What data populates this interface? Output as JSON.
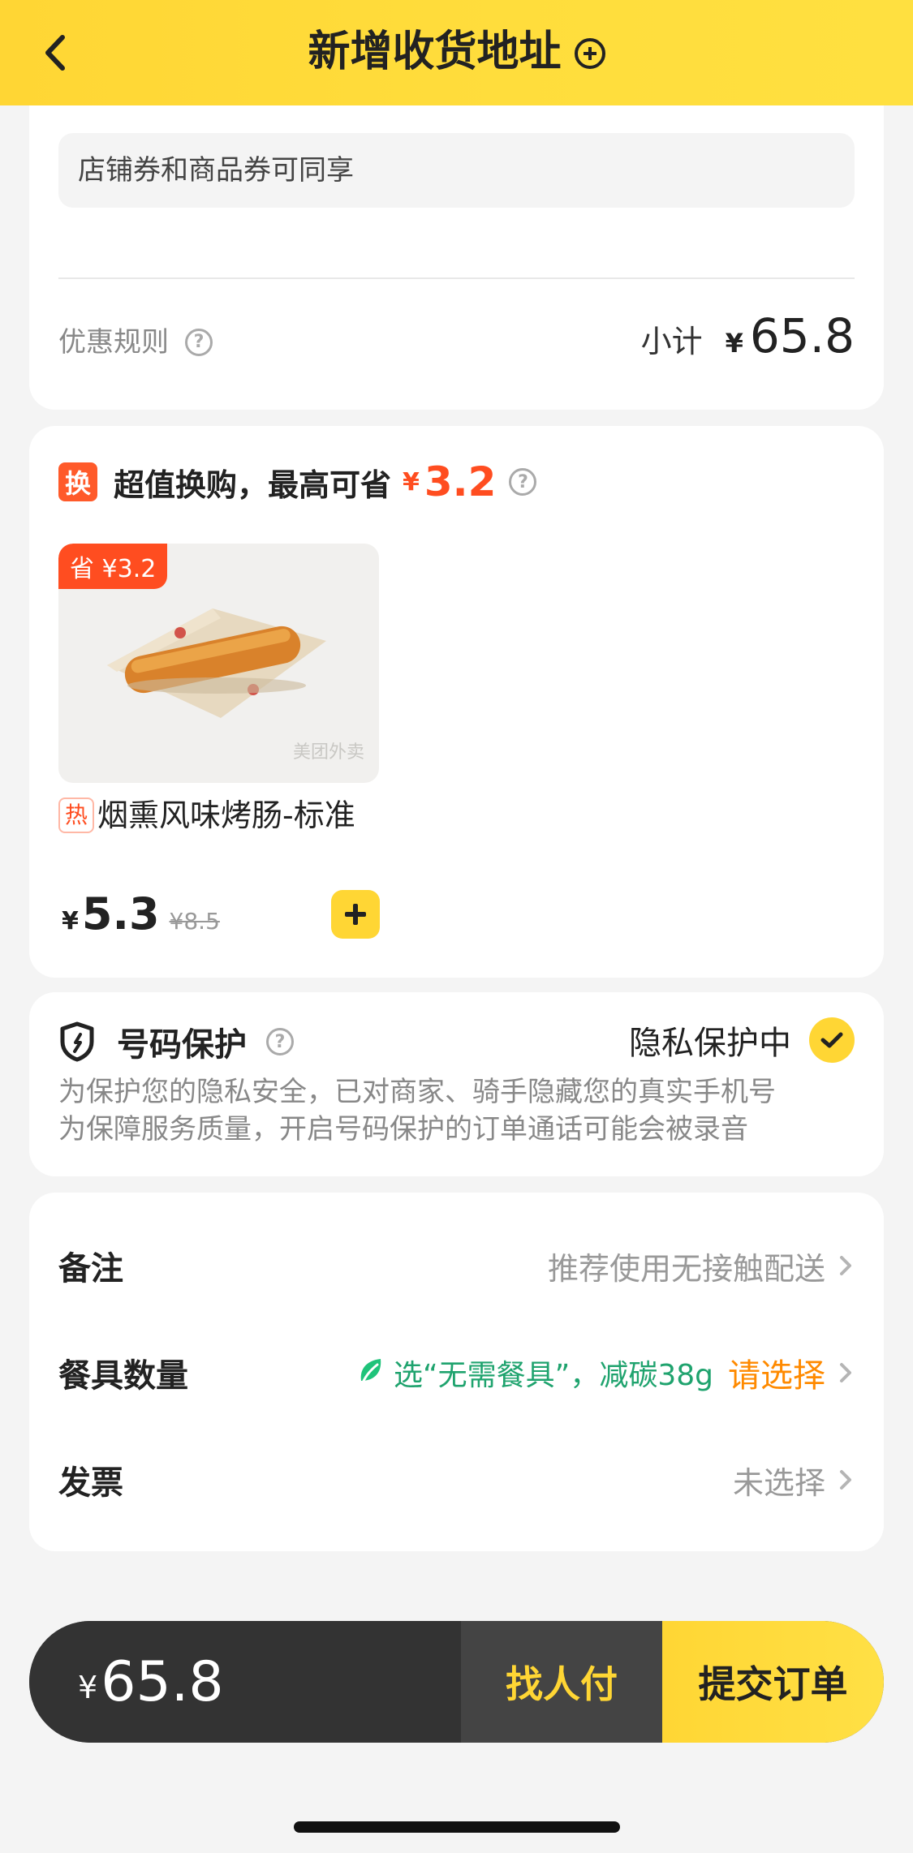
{
  "header": {
    "title": "新增收货地址"
  },
  "discount_card": {
    "coupon_note": "店铺券和商品券可同享",
    "rule_label": "优惠规则",
    "subtotal_label": "小计",
    "currency": "¥",
    "subtotal_value": "65.8"
  },
  "exchange": {
    "icon_char": "换",
    "title": "超值换购，最高可省",
    "currency": "¥",
    "max_save": "3.2",
    "product": {
      "save_tag": "省 ¥3.2",
      "watermark": "美团外卖",
      "hot_tag": "热",
      "name": "烟熏风味烤肠-标准",
      "currency": "¥",
      "price": "5.3",
      "original_price": "¥8.5"
    }
  },
  "phone_protect": {
    "title": "号码保护",
    "status": "隐私保护中",
    "desc_line1": "为保护您的隐私安全，已对商家、骑手隐藏您的真实手机号",
    "desc_line2": "为保障服务质量，开启号码保护的订单通话可能会被录音"
  },
  "options": {
    "remark_label": "备注",
    "remark_value": "推荐使用无接触配送",
    "tableware_label": "餐具数量",
    "tableware_hint": "选“无需餐具”，减碳38g",
    "tableware_action": "请选择",
    "invoice_label": "发票",
    "invoice_value": "未选择"
  },
  "bottom_bar": {
    "currency": "¥",
    "total": "65.8",
    "find_pay_label": "找人付",
    "submit_label": "提交订单"
  },
  "colors": {
    "brand_yellow": "#FFD634",
    "accent_red": "#FF4D20",
    "green": "#1FA36E",
    "orange": "#FF8A00"
  }
}
